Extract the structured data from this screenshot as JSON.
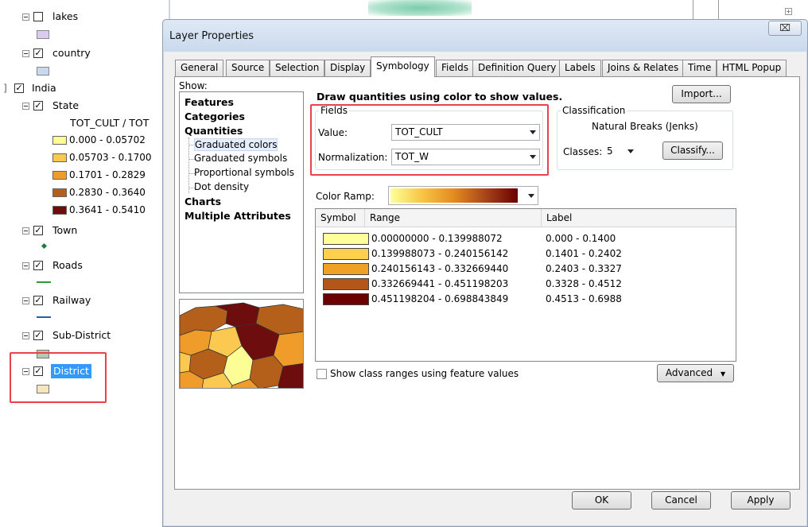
{
  "toc": {
    "lakes": "lakes",
    "country": "country",
    "india": "India",
    "state": "State",
    "state_field": "TOT_CULT / TOT",
    "legend": [
      {
        "label": "0.000 - 0.05702",
        "color": "#fdfd96"
      },
      {
        "label": "0.05703 - 0.1700",
        "color": "#fbc94f"
      },
      {
        "label": "0.1701 - 0.2829",
        "color": "#ef9c2a"
      },
      {
        "label": "0.2830 - 0.3640",
        "color": "#b5601a"
      },
      {
        "label": "0.3641 - 0.5410",
        "color": "#6d0d0d"
      }
    ],
    "town": "Town",
    "roads": "Roads",
    "railway": "Railway",
    "subdistrict": "Sub-District",
    "district": "District"
  },
  "dialog": {
    "title": "Layer Properties",
    "close": "⌧",
    "tabs": [
      "General",
      "Source",
      "Selection",
      "Display",
      "Symbology",
      "Fields",
      "Definition Query",
      "Labels",
      "Joins & Relates",
      "Time",
      "HTML Popup"
    ],
    "active_tab": "Symbology",
    "show_label": "Show:",
    "show_items": {
      "features": "Features",
      "categories": "Categories",
      "quantities": "Quantities",
      "graduated_colors": "Graduated colors",
      "graduated_symbols": "Graduated symbols",
      "proportional_symbols": "Proportional symbols",
      "dot_density": "Dot density",
      "charts": "Charts",
      "multiple_attributes": "Multiple Attributes"
    },
    "draw_title": "Draw quantities using color to show values.",
    "import": "Import...",
    "fields_title": "Fields",
    "value_label": "Value:",
    "value": "TOT_CULT",
    "normalization_label": "Normalization:",
    "normalization": "TOT_W",
    "classification_title": "Classification",
    "classification_method": "Natural Breaks (Jenks)",
    "classes_label": "Classes:",
    "classes": "5",
    "classify": "Classify...",
    "color_ramp_label": "Color Ramp:",
    "table_headers": {
      "symbol": "Symbol",
      "range": "Range",
      "label": "Label"
    },
    "classes_table": [
      {
        "range": "0.00000000 - 0.139988072",
        "label": "0.000 - 0.1400",
        "color": "#ffff99"
      },
      {
        "range": "0.139988073 - 0.240156142",
        "label": "0.1401 - 0.2402",
        "color": "#fdd14f"
      },
      {
        "range": "0.240156143 - 0.332669440",
        "label": "0.2403 - 0.3327",
        "color": "#f0a024"
      },
      {
        "range": "0.332669441 - 0.451198203",
        "label": "0.3328 - 0.4512",
        "color": "#b4551a"
      },
      {
        "range": "0.451198204 - 0.698843849",
        "label": "0.4513 - 0.6988",
        "color": "#6c0000"
      }
    ],
    "show_ranges": "Show class ranges using feature values",
    "advanced": "Advanced",
    "ok": "OK",
    "cancel": "Cancel",
    "apply": "Apply"
  }
}
